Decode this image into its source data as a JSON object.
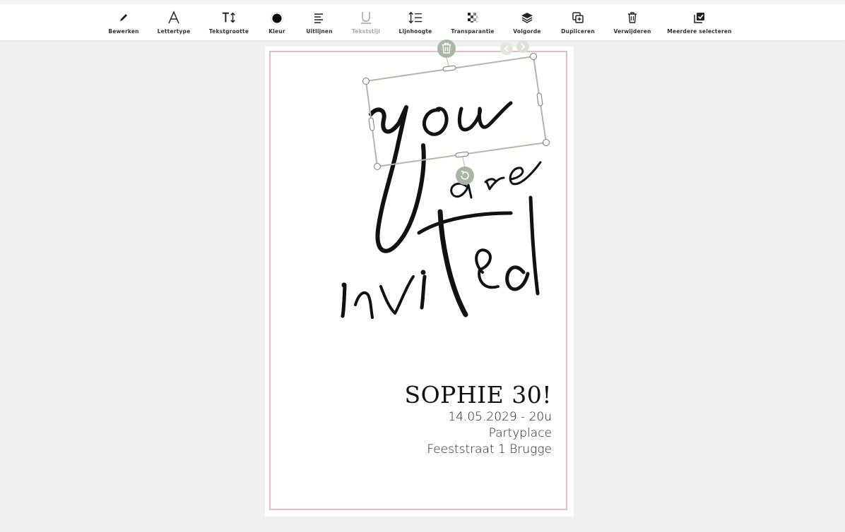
{
  "toolbar": {
    "tools": [
      {
        "id": "edit",
        "label": "Bewerken",
        "icon": "pencil-icon",
        "enabled": true
      },
      {
        "id": "font",
        "label": "Lettertype",
        "icon": "font-a-icon",
        "enabled": true
      },
      {
        "id": "size",
        "label": "Tekstgrootte",
        "icon": "text-size-icon",
        "enabled": true
      },
      {
        "id": "color",
        "label": "Kleur",
        "icon": "color-dot-icon",
        "enabled": true
      },
      {
        "id": "align",
        "label": "Uitlijnen",
        "icon": "align-left-icon",
        "enabled": true
      },
      {
        "id": "style",
        "label": "Tekststijl",
        "icon": "underline-icon",
        "enabled": false
      },
      {
        "id": "lineheight",
        "label": "Lijnhoogte",
        "icon": "line-height-icon",
        "enabled": true
      },
      {
        "id": "transparency",
        "label": "Transparantie",
        "icon": "checker-icon",
        "enabled": true
      },
      {
        "id": "order",
        "label": "Volgorde",
        "icon": "layers-icon",
        "enabled": true
      },
      {
        "id": "duplicate",
        "label": "Dupliceren",
        "icon": "duplicate-icon",
        "enabled": true
      },
      {
        "id": "delete",
        "label": "Verwijderen",
        "icon": "trash-icon",
        "enabled": true
      },
      {
        "id": "multiselect",
        "label": "Meerdere selecteren",
        "icon": "multi-select-icon",
        "enabled": true
      }
    ]
  },
  "canvas": {
    "colors": {
      "background": "#eff0ef",
      "card": "#ffffff",
      "frame_border": "#f2b8c0",
      "selection": "#b5b6ab",
      "handle_fill": "#aab5a5"
    },
    "artwork": {
      "words": [
        "you",
        "are",
        "invited"
      ]
    },
    "invite": {
      "headline": "SOPHIE 30!",
      "date_time": "14.05.2029 - 20u",
      "venue": "Partyplace",
      "address": "Feeststraat 1 Brugge"
    }
  }
}
